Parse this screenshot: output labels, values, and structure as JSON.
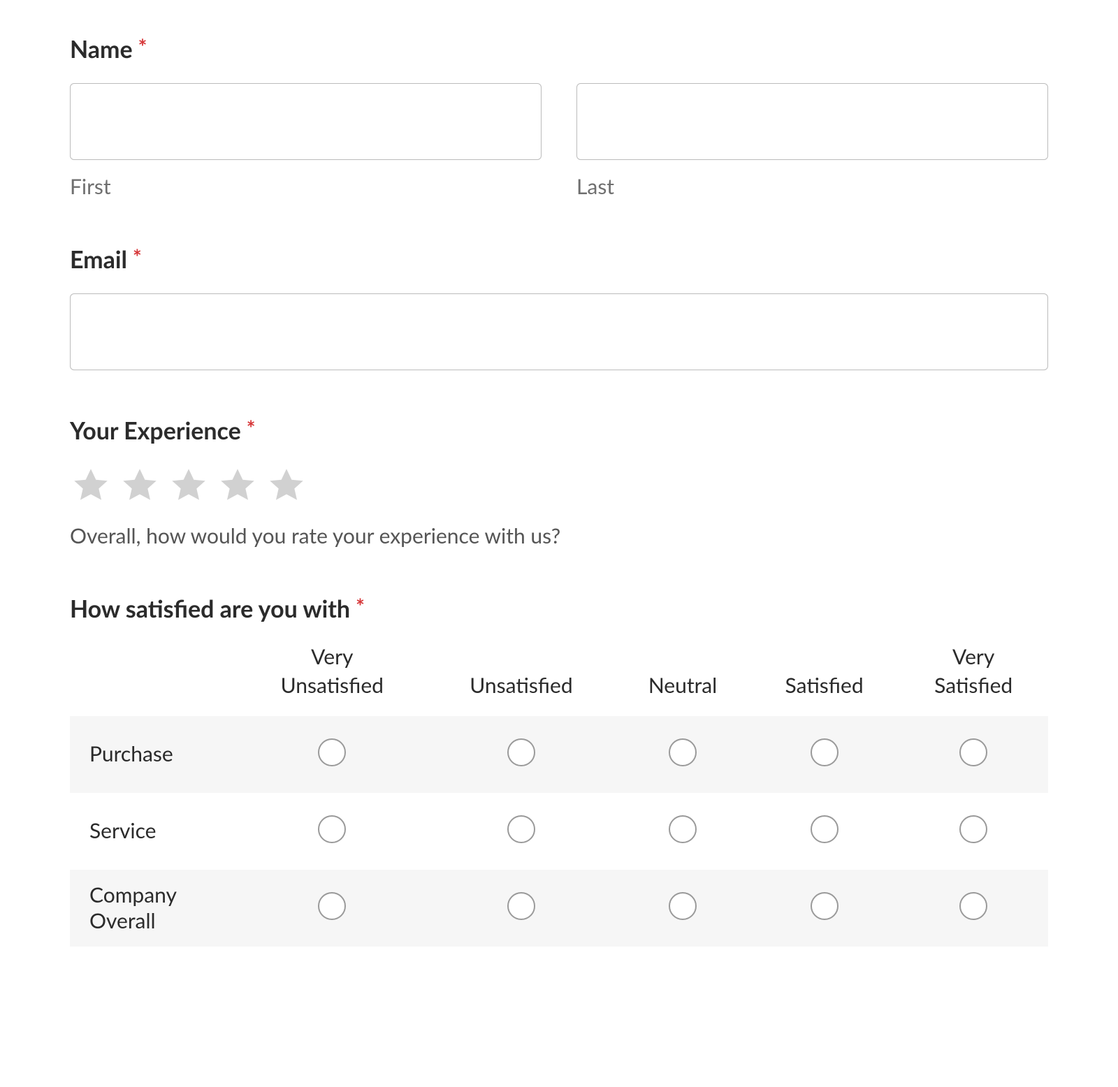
{
  "form": {
    "name": {
      "label": "Name",
      "required_mark": "*",
      "first_sublabel": "First",
      "last_sublabel": "Last",
      "first_value": "",
      "last_value": ""
    },
    "email": {
      "label": "Email",
      "required_mark": "*",
      "value": ""
    },
    "experience": {
      "label": "Your Experience",
      "required_mark": "*",
      "help_text": "Overall, how would you rate your experience with us?",
      "star_count": 5,
      "selected": 0
    },
    "satisfaction": {
      "label": "How satisfied are you with",
      "required_mark": "*",
      "columns": [
        "Very Unsatisfied",
        "Unsatisfied",
        "Neutral",
        "Satisfied",
        "Very Satisfied"
      ],
      "columns_display": [
        "Very\nUnsatisfied",
        "Unsatisfied",
        "Neutral",
        "Satisfied",
        "Very\nSatisfied"
      ],
      "rows": [
        {
          "label": "Purchase"
        },
        {
          "label": "Service"
        },
        {
          "label": "Company Overall",
          "label_display": "Company\nOverall"
        }
      ]
    }
  }
}
